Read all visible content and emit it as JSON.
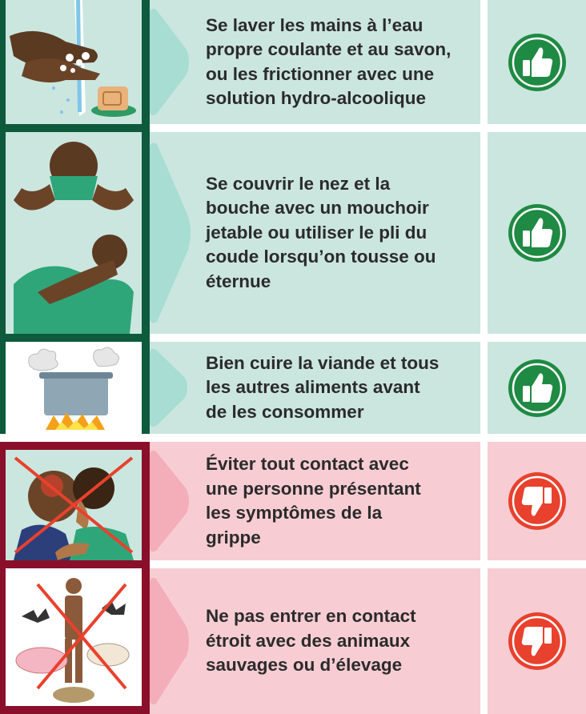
{
  "colors": {
    "do_band": "#0d5a3c",
    "do_cell": "#cbe6df",
    "do_chevron": "#a7ddd2",
    "do_icon": "#1f8a43",
    "dont_band": "#8a0f2a",
    "dont_cell": "#f7cdd3",
    "dont_chevron": "#f3aeb9",
    "dont_icon": "#e8412d",
    "text": "#2b2b2b"
  },
  "dos": [
    {
      "text": "Se laver les mains à l’eau\npropre coulante et au savon,\nou les frictionner avec une\nsolution hydro-alcoolique",
      "illustration": "hand-washing",
      "icon": "thumbs-up-icon"
    },
    {
      "text": "Se couvrir le nez et la\nbouche avec un mouchoir\njetable ou utiliser le pli du\ncoude lorsqu’on tousse ou\néternue",
      "illustration": "cough-sneeze-cover",
      "icon": "thumbs-up-icon"
    },
    {
      "text": "Bien cuire la viande et tous\nles autres aliments avant\nde les consommer",
      "illustration": "cooking-pot",
      "icon": "thumbs-up-icon"
    }
  ],
  "donts": [
    {
      "text": "Éviter tout contact avec\nune personne présentant\nles symptômes de la\ngrippe",
      "illustration": "contact-with-sick-person",
      "icon": "thumbs-down-icon"
    },
    {
      "text": "Ne pas entrer en contact\nétroit avec des animaux\nsauvages ou d’élevage",
      "illustration": "contact-with-animals",
      "icon": "thumbs-down-icon"
    }
  ]
}
